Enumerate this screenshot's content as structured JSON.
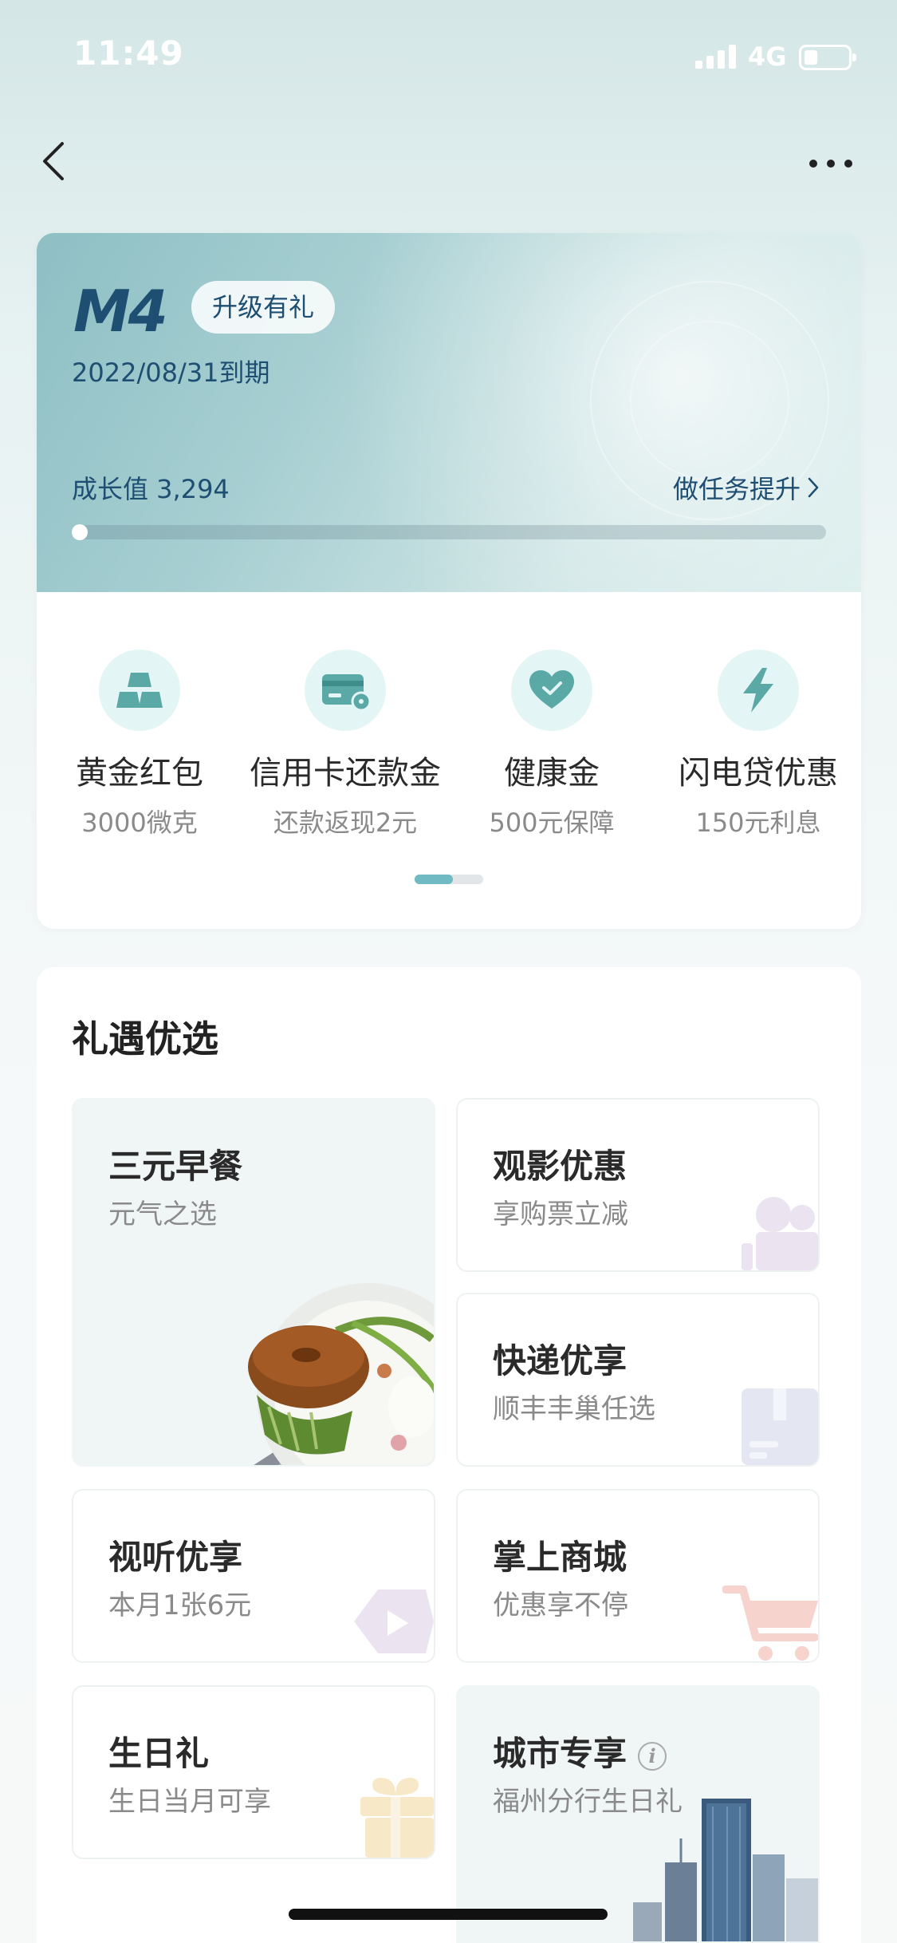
{
  "status_bar": {
    "time": "11:49",
    "network": "4G"
  },
  "nav": {
    "back_icon": "chevron-left-icon",
    "more_icon": "more-icon"
  },
  "membership": {
    "level": "M4",
    "upgrade_badge": "升级有礼",
    "expiry": "2022/08/31到期",
    "growth_label": "成长值 3,294",
    "task_link": "做任务提升",
    "progress_fraction": 0.005
  },
  "benefits": [
    {
      "title": "黄金红包",
      "subtitle": "3000微克",
      "icon": "gold-bars-icon"
    },
    {
      "title": "信用卡还款金",
      "subtitle": "还款返现2元",
      "icon": "credit-card-icon"
    },
    {
      "title": "健康金",
      "subtitle": "500元保障",
      "icon": "heart-check-icon"
    },
    {
      "title": "闪电贷优惠",
      "subtitle": "150元利息",
      "icon": "lightning-icon"
    }
  ],
  "benefits_pager": {
    "current": 1,
    "total": 2
  },
  "gifts": {
    "title": "礼遇优选",
    "tiles": [
      {
        "title": "三元早餐",
        "subtitle": "元气之选"
      },
      {
        "title": "观影优惠",
        "subtitle": "享购票立减"
      },
      {
        "title": "快递优享",
        "subtitle": "顺丰丰巢任选"
      },
      {
        "title": "视听优享",
        "subtitle": "本月1张6元"
      },
      {
        "title": "掌上商城",
        "subtitle": "优惠享不停"
      },
      {
        "title": "生日礼",
        "subtitle": "生日当月可享"
      },
      {
        "title": "城市专享",
        "subtitle": "福州分行生日礼"
      }
    ],
    "info_icon_text": "i"
  },
  "colors": {
    "accent": "#6fbac3",
    "level_text": "#1e4e72",
    "icon_teal": "#5aa9a6"
  }
}
